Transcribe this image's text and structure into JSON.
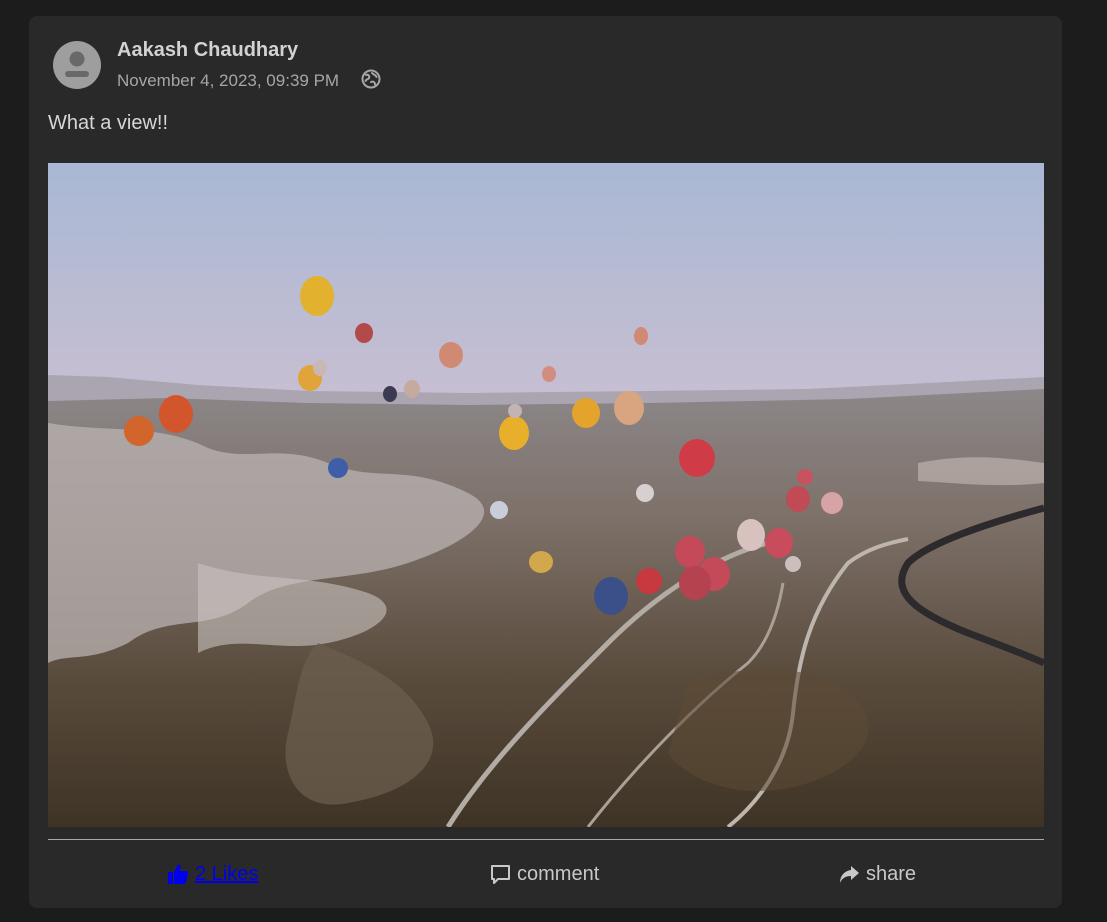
{
  "post": {
    "author": "Aakash Chaudhary",
    "timestamp": "November 4, 2023, 09:39 PM",
    "visibility_icon": "globe-icon",
    "text": "What a view!!",
    "image_description_icon": "photo"
  },
  "actions": {
    "likes_label": "2 Likes",
    "comment_label": "comment",
    "share_label": "share"
  },
  "colors": {
    "page_bg": "#1c1c1c",
    "card_bg": "#292929",
    "like_blue": "#0000ee",
    "muted_text": "#a6a6a6"
  }
}
